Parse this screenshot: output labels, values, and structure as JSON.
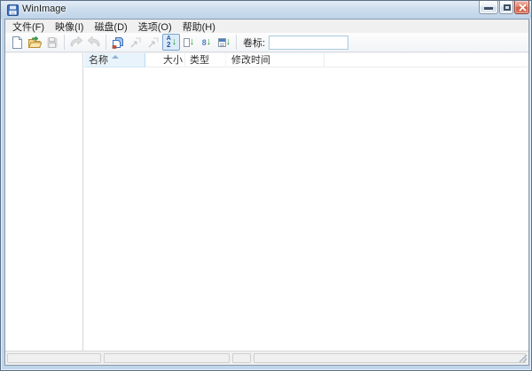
{
  "window": {
    "title": "WinImage"
  },
  "menubar": {
    "items": [
      {
        "label": "文件(F)"
      },
      {
        "label": "映像(I)"
      },
      {
        "label": "磁盘(D)"
      },
      {
        "label": "选项(O)"
      },
      {
        "label": "帮助(H)"
      }
    ]
  },
  "toolbar": {
    "buttons": [
      {
        "icon": "new-image-icon",
        "enabled": true
      },
      {
        "icon": "open-image-icon",
        "enabled": true
      },
      {
        "icon": "save-image-icon",
        "enabled": false
      },
      {
        "icon": "extract-files-icon",
        "enabled": false
      },
      {
        "icon": "inject-files-icon",
        "enabled": false
      },
      {
        "icon": "add-files-icon",
        "enabled": true
      },
      {
        "icon": "change-format-icon",
        "enabled": false
      },
      {
        "icon": "change-size-icon",
        "enabled": false
      },
      {
        "icon": "sort-by-name-icon",
        "enabled": true,
        "pressed": true
      },
      {
        "icon": "sort-by-extension-icon",
        "enabled": true
      },
      {
        "icon": "sort-by-size-icon",
        "enabled": true
      },
      {
        "icon": "sort-by-date-icon",
        "enabled": true
      }
    ],
    "sort_glyphs": {
      "name_top": "A",
      "name_bottom": "2",
      "size_glyph": "8",
      "arrow": "↓"
    },
    "volume_label": "卷标:",
    "volume_value": ""
  },
  "list": {
    "columns": [
      {
        "label": "名称",
        "sorted": "asc"
      },
      {
        "label": "大小"
      },
      {
        "label": "类型"
      },
      {
        "label": "修改时间"
      }
    ],
    "rows": []
  },
  "statusbar": {
    "panels": [
      "",
      "",
      "",
      ""
    ]
  },
  "colors": {
    "titlebar": "#cdddee",
    "frame": "#c1d5e9",
    "frame_border": "#5c6f86",
    "sorted_column_bg": "#e8f3fb",
    "pressed_button_bg": "#dcebfa",
    "pressed_button_border": "#79a4cc",
    "green_arrow": "#1e9e2e",
    "close_button": "#cf604a",
    "toolbar_bg": "#f6f8fa",
    "statusbar_bg": "#f0f0f0"
  }
}
